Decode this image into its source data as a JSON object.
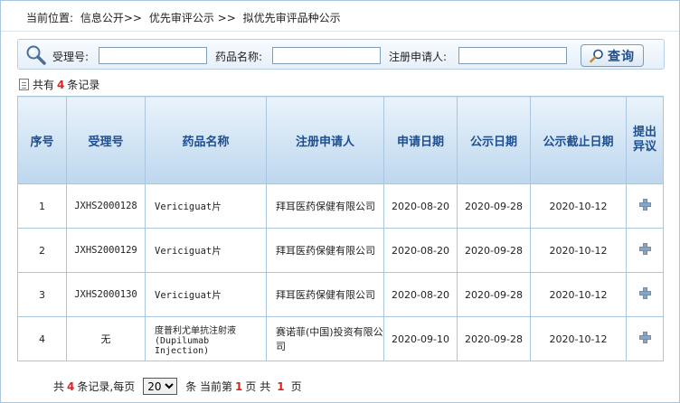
{
  "breadcrumb": {
    "prefix": "当前位置:",
    "path1": "信息公开>>",
    "path2": "优先审评公示 >>",
    "path3": "拟优先审评品种公示"
  },
  "search": {
    "field1_label": "受理号:",
    "field2_label": "药品名称:",
    "field3_label": "注册申请人:",
    "field1_value": "",
    "field2_value": "",
    "field3_value": "",
    "button_label": "查询"
  },
  "records": {
    "prefix": "共有",
    "count": "4",
    "suffix": "条记录"
  },
  "table": {
    "headers": [
      "序号",
      "受理号",
      "药品名称",
      "注册申请人",
      "申请日期",
      "公示日期",
      "公示截止日期",
      "提出异议"
    ],
    "rows": [
      {
        "no": "1",
        "accept_no": "JXHS2000128",
        "drug": "Vericiguat片",
        "applicant": "拜耳医药保健有限公司",
        "apply_date": "2020-08-20",
        "publish_date": "2020-09-28",
        "deadline": "2020-10-12"
      },
      {
        "no": "2",
        "accept_no": "JXHS2000129",
        "drug": "Vericiguat片",
        "applicant": "拜耳医药保健有限公司",
        "apply_date": "2020-08-20",
        "publish_date": "2020-09-28",
        "deadline": "2020-10-12"
      },
      {
        "no": "3",
        "accept_no": "JXHS2000130",
        "drug": "Vericiguat片",
        "applicant": "拜耳医药保健有限公司",
        "apply_date": "2020-08-20",
        "publish_date": "2020-09-28",
        "deadline": "2020-10-12"
      },
      {
        "no": "4",
        "accept_no": "无",
        "drug": "度普利尤单抗注射液(Dupilumab Injection)",
        "applicant": "赛诺菲(中国)投资有限公司",
        "apply_date": "2020-09-10",
        "publish_date": "2020-09-28",
        "deadline": "2020-10-12"
      }
    ]
  },
  "pager": {
    "t1": "共",
    "total": "4",
    "t2": "条记录,每页",
    "page_size": "20",
    "t3": "条 当前第",
    "current": "1",
    "t4": "页 共",
    "pages": "1",
    "t5": "页"
  },
  "colors": {
    "header_text": "#1d4f91",
    "border": "#a9c6de",
    "highlight": "#e02020"
  },
  "icons": {
    "search": "magnifier-icon",
    "record": "document-icon",
    "objection": "plus-icon"
  }
}
